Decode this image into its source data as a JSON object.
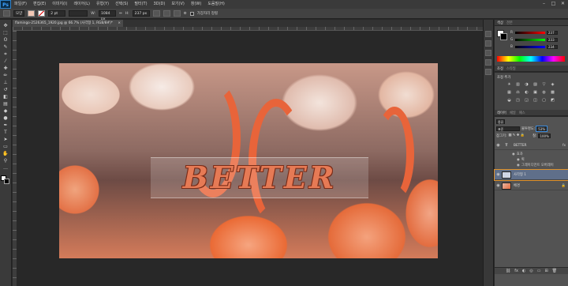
{
  "app": {
    "logo": "Ps"
  },
  "menu": [
    "파일(F)",
    "편집(E)",
    "이미지(I)",
    "레이어(L)",
    "유형(Y)",
    "선택(S)",
    "필터(T)",
    "3D(D)",
    "보기(V)",
    "창(W)",
    "도움말(H)"
  ],
  "window_controls": [
    "–",
    "□",
    "✕"
  ],
  "options": {
    "mode": "모양",
    "stroke_size": "2 pt",
    "w_label": "W:",
    "w_value": "1084 px",
    "link": "⇔",
    "h_label": "H:",
    "h_value": "237 px",
    "align_edges": "가장자리 정렬"
  },
  "document_tab": {
    "title": "flamingo-2526365_1920.jpg @ 66.7% (사각형 1, RGB/8#)*",
    "close": "×"
  },
  "toolbar": {
    "tools": [
      {
        "name": "move-tool",
        "glyph": "✥"
      },
      {
        "name": "marquee-tool",
        "glyph": "⬚"
      },
      {
        "name": "lasso-tool",
        "glyph": "ʘ"
      },
      {
        "name": "quick-select-tool",
        "glyph": "✎"
      },
      {
        "name": "crop-tool",
        "glyph": "⌗"
      },
      {
        "name": "eyedropper-tool",
        "glyph": "⁄"
      },
      {
        "name": "healing-tool",
        "glyph": "✚"
      },
      {
        "name": "brush-tool",
        "glyph": "✏"
      },
      {
        "name": "clone-stamp-tool",
        "glyph": "⊥"
      },
      {
        "name": "history-brush-tool",
        "glyph": "↺"
      },
      {
        "name": "eraser-tool",
        "glyph": "◧"
      },
      {
        "name": "gradient-tool",
        "glyph": "▤"
      },
      {
        "name": "blur-tool",
        "glyph": "◆"
      },
      {
        "name": "dodge-tool",
        "glyph": "●"
      },
      {
        "name": "pen-tool",
        "glyph": "✒"
      },
      {
        "name": "type-tool",
        "glyph": "T"
      },
      {
        "name": "path-select-tool",
        "glyph": "➤"
      },
      {
        "name": "shape-tool",
        "glyph": "▭"
      },
      {
        "name": "hand-tool",
        "glyph": "✋"
      },
      {
        "name": "zoom-tool",
        "glyph": "⚲"
      },
      {
        "name": "more-tools",
        "glyph": "…"
      }
    ]
  },
  "artwork": {
    "headline": "BETTER"
  },
  "color_panel": {
    "tabs": [
      "색상",
      "견본"
    ],
    "sliders": [
      {
        "label": "R",
        "value": "237",
        "gradient": "linear-gradient(90deg,#000,#f00)"
      },
      {
        "label": "G",
        "value": "233",
        "gradient": "linear-gradient(90deg,#000,#0f0)"
      },
      {
        "label": "B",
        "value": "234",
        "gradient": "linear-gradient(90deg,#000,#00f)"
      }
    ]
  },
  "adjust_panel": {
    "tabs": [
      "조정",
      "스타일"
    ],
    "title": "조정 추가",
    "icons": [
      "☀",
      "▥",
      "◑",
      "▨",
      "▽",
      "◈",
      "▦",
      "⚖",
      "◐",
      "▣",
      "◍",
      "▩",
      "◒",
      "◳",
      "◲",
      "◫",
      "▢",
      "◩"
    ]
  },
  "layers_panel": {
    "tabs": [
      "레이어",
      "채널",
      "패스"
    ],
    "kind_label": "종류",
    "blend_mode": "표준",
    "opacity_label": "불투명도:",
    "opacity_value": "53%",
    "lock_label": "잠그기:",
    "fill_label": "칠:",
    "fill_value": "100%",
    "layers": [
      {
        "name": "BETTER",
        "type": "text",
        "fx": "fx"
      },
      {
        "name": "사각형 1",
        "type": "shape",
        "selected": true
      },
      {
        "name": "배경",
        "type": "background"
      }
    ],
    "effects_label": "효과",
    "effects": [
      "획",
      "그레이디언트 오버레이"
    ],
    "footer_icons": [
      "⛓",
      "fx",
      "◐",
      "◎",
      "▭",
      "⊞",
      "🗑"
    ]
  },
  "panel_strip_icons": [
    "history-icon",
    "actions-icon",
    "properties-icon",
    "info-icon",
    "character-icon"
  ]
}
